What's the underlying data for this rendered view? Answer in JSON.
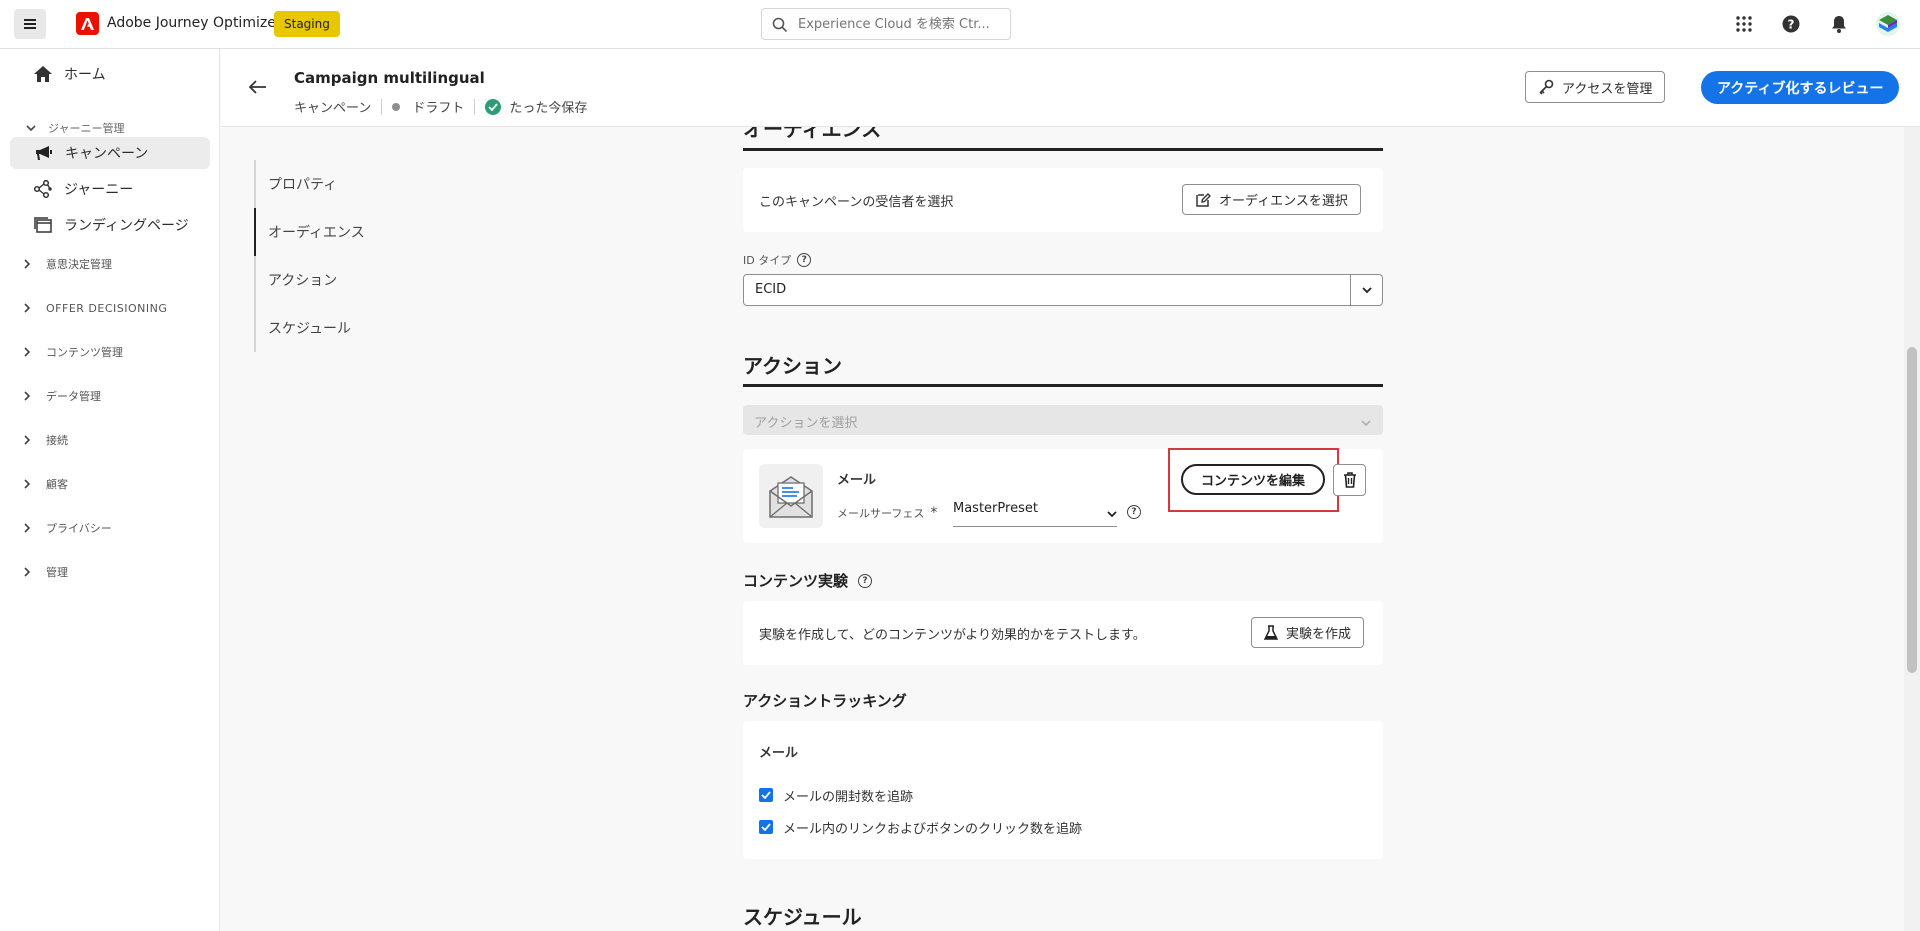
{
  "topbar": {
    "app_title": "Adobe Journey Optimizer",
    "env_badge": "Staging",
    "search_placeholder": "Experience Cloud を検索 Ctr..."
  },
  "sidebar": {
    "home": "ホーム",
    "journey_mgmt": "ジャーニー管理",
    "campaigns": "キャンペーン",
    "journeys": "ジャーニー",
    "landing_pages": "ランディングページ",
    "decision_mgmt": "意思決定管理",
    "offer_decisioning": "OFFER DECISIONING",
    "content_mgmt": "コンテンツ管理",
    "data_mgmt": "データ管理",
    "connections": "接続",
    "customers": "顧客",
    "privacy": "プライバシー",
    "admin": "管理"
  },
  "header": {
    "campaign_title": "Campaign multilingual",
    "type": "キャンペーン",
    "status": "ドラフト",
    "saved": "たった今保存",
    "manage_access": "アクセスを管理",
    "activate_review": "アクティブ化するレビュー"
  },
  "section_nav": {
    "properties": "プロパティ",
    "audience": "オーディエンス",
    "actions": "アクション",
    "schedule": "スケジュール"
  },
  "audience": {
    "heading": "オーディエンス",
    "description": "このキャンペーンの受信者を選択",
    "select_button": "オーディエンスを選択",
    "id_type_label": "ID タイプ",
    "id_type_value": "ECID"
  },
  "actions": {
    "heading": "アクション",
    "select_placeholder": "アクションを選択",
    "email_label": "メール",
    "surface_label": "メールサーフェス",
    "surface_value": "MasterPreset",
    "edit_content": "コンテンツを編集"
  },
  "experiment": {
    "heading": "コンテンツ実験",
    "description": "実験を作成して、どのコンテンツがより効果的かをテストします。",
    "create_button": "実験を作成"
  },
  "tracking": {
    "heading": "アクショントラッキング",
    "email_label": "メール",
    "track_opens": "メールの開封数を追跡",
    "track_clicks": "メール内のリンクおよびボタンのクリック数を追跡"
  },
  "schedule": {
    "heading": "スケジュール"
  },
  "colors": {
    "primary": "#1473e6",
    "badge": "#e8c600",
    "highlight": "#d7373f",
    "success": "#2d9d78"
  }
}
